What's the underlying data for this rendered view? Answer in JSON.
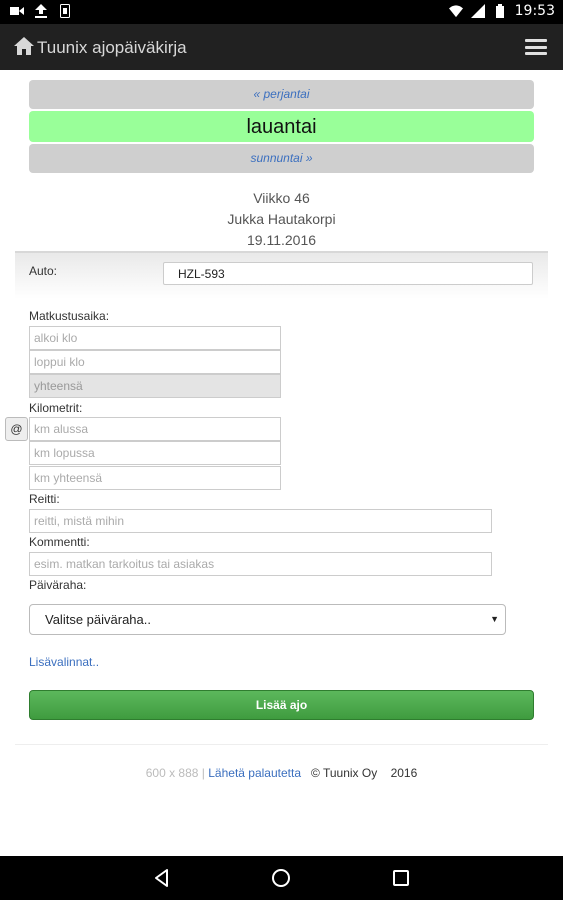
{
  "status_bar": {
    "time": "19:53",
    "left_icons": [
      "video-icon",
      "upload-icon",
      "device-icon"
    ],
    "right_icons": [
      "wifi-icon",
      "signal-icon",
      "battery-icon"
    ]
  },
  "app_bar": {
    "title": "Tuunix ajopäiväkirja",
    "icons": [
      "home-icon",
      "menu-icon"
    ]
  },
  "day_nav": {
    "previous": "« perjantai",
    "current": "lauantai",
    "next": "sunnuntai »",
    "current_color": "#99ff99"
  },
  "info": {
    "week": "Viikko 46",
    "name": "Jukka Hautakorpi",
    "date": "19.11.2016"
  },
  "form": {
    "auto_label": "Auto:",
    "auto_value": "HZL-593",
    "travel_time_label": "Matkustusaika:",
    "start_placeholder": "alkoi klo",
    "end_placeholder": "loppui klo",
    "total_placeholder": "yhteensä",
    "km_label": "Kilometrit:",
    "at_button": "@",
    "km_start_placeholder": "km alussa",
    "km_end_placeholder": "km lopussa",
    "km_total_placeholder": "km yhteensä",
    "route_label": "Reitti:",
    "route_placeholder": "reitti, mistä mihin",
    "comment_label": "Kommentti:",
    "comment_placeholder": "esim. matkan tarkoitus tai asiakas",
    "allowance_label": "Päiväraha:",
    "allowance_selected": "Valitse päiväraha..",
    "more_options": "Lisävalinnat..",
    "add_button": "Lisää ajo",
    "add_button_color": "#4cae4c"
  },
  "footer": {
    "size": "600 x 888",
    "separator": "|",
    "feedback": "Lähetä palautetta",
    "copyright": "© Tuunix Oy",
    "year": "2016"
  },
  "nav_bar": {
    "icons": [
      "back-icon",
      "home-circle-icon",
      "recents-icon"
    ]
  }
}
